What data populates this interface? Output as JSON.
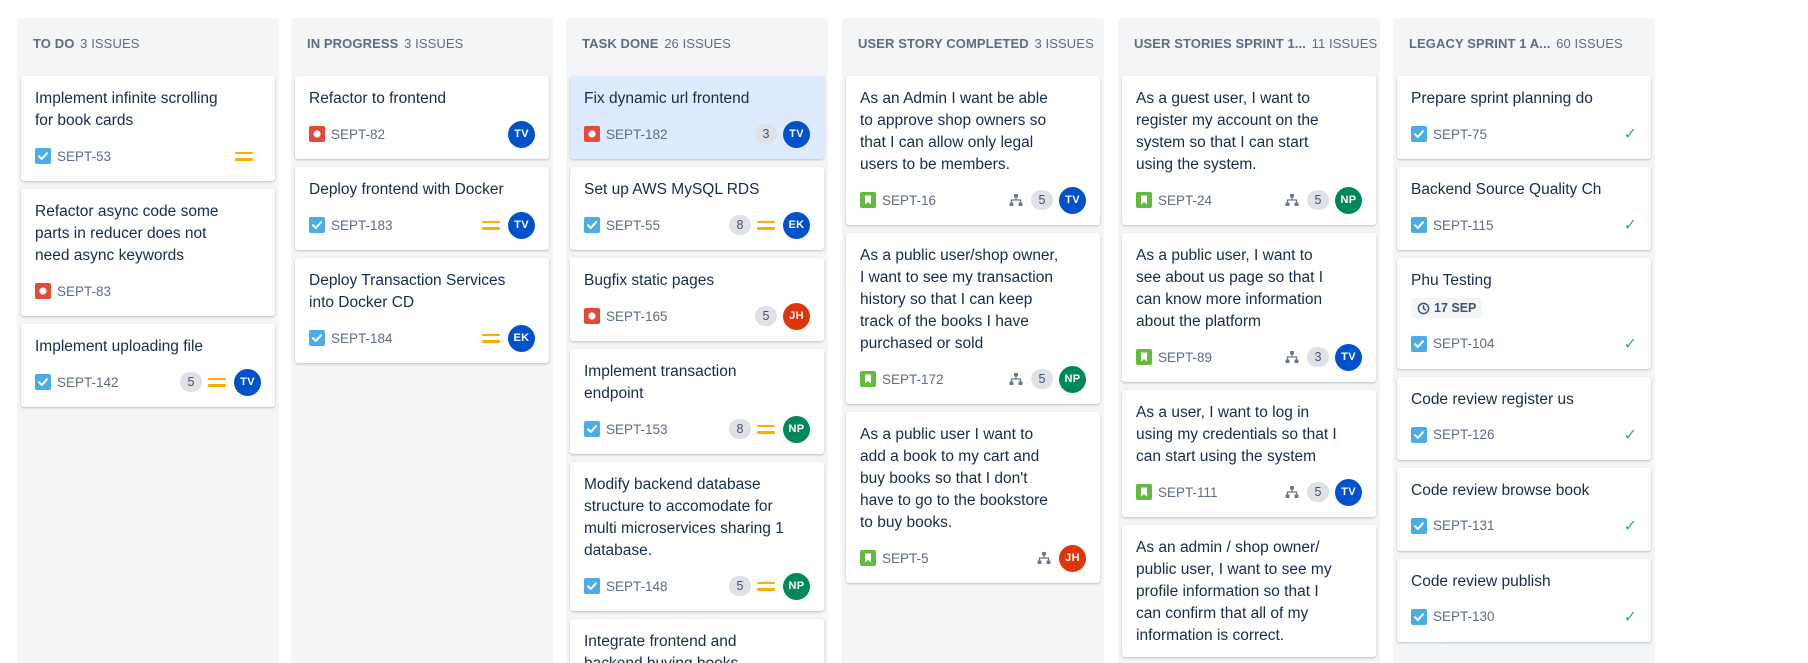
{
  "columns": [
    {
      "name": "TO DO",
      "count": "3 ISSUES",
      "cards": [
        {
          "title": "Implement infinite scrolling for book cards",
          "type": "task",
          "key": "SEPT-53",
          "estimate": "",
          "priority": "medium",
          "subtasks": false,
          "assignee": null
        },
        {
          "title": "Refactor async code some parts in reducer does not need async keywords",
          "type": "bug",
          "key": "SEPT-83",
          "estimate": "",
          "priority": "",
          "subtasks": false,
          "assignee": null
        },
        {
          "title": "Implement uploading file",
          "type": "task",
          "key": "SEPT-142",
          "estimate": "5",
          "priority": "medium",
          "subtasks": false,
          "assignee": "TV"
        }
      ]
    },
    {
      "name": "IN PROGRESS",
      "count": "3 ISSUES",
      "cards": [
        {
          "title": "Refactor to frontend",
          "type": "bug",
          "key": "SEPT-82",
          "estimate": "",
          "priority": "",
          "subtasks": false,
          "assignee": "TV"
        },
        {
          "title": "Deploy frontend with Docker",
          "type": "task",
          "key": "SEPT-183",
          "estimate": "",
          "priority": "medium",
          "subtasks": false,
          "assignee": "TV"
        },
        {
          "title": "Deploy Transaction Services into Docker CD",
          "type": "task",
          "key": "SEPT-184",
          "estimate": "",
          "priority": "medium",
          "subtasks": false,
          "assignee": "EK"
        }
      ]
    },
    {
      "name": "TASK DONE",
      "count": "26 ISSUES",
      "cards": [
        {
          "title": "Fix dynamic url frontend",
          "type": "bug",
          "key": "SEPT-182",
          "estimate": "3",
          "priority": "",
          "subtasks": false,
          "assignee": "TV",
          "selected": true
        },
        {
          "title": "Set up AWS MySQL RDS",
          "type": "task",
          "key": "SEPT-55",
          "estimate": "8",
          "priority": "medium",
          "subtasks": false,
          "assignee": "EK"
        },
        {
          "title": "Bugfix static pages",
          "type": "bug",
          "key": "SEPT-165",
          "estimate": "5",
          "priority": "",
          "subtasks": false,
          "assignee": "JH"
        },
        {
          "title": "Implement transaction endpoint",
          "type": "task",
          "key": "SEPT-153",
          "estimate": "8",
          "priority": "medium",
          "subtasks": false,
          "assignee": "NP"
        },
        {
          "title": "Modify backend database structure to accomodate for multi microservices sharing 1 database.",
          "type": "task",
          "key": "SEPT-148",
          "estimate": "5",
          "priority": "medium",
          "subtasks": false,
          "assignee": "NP"
        },
        {
          "title": "Integrate frontend and backend buying books",
          "type": "task",
          "key": "",
          "estimate": "",
          "priority": "",
          "subtasks": false,
          "assignee": null
        }
      ]
    },
    {
      "name": "USER STORY COMPLETED",
      "count": "3 ISSUES",
      "cards": [
        {
          "title": "As an Admin I want be able to approve shop owners so that I can allow only legal users to be members.",
          "type": "story",
          "key": "SEPT-16",
          "estimate": "5",
          "priority": "",
          "subtasks": true,
          "assignee": "TV"
        },
        {
          "title": "As a public user/shop owner, I want to see my transaction history so that I can keep track of the books I have purchased or sold",
          "type": "story",
          "key": "SEPT-172",
          "estimate": "5",
          "priority": "",
          "subtasks": true,
          "assignee": "NP"
        },
        {
          "title": "As a public user I want to add a book to my cart and buy books so that I don't have to go to the bookstore to buy books.",
          "type": "story",
          "key": "SEPT-5",
          "estimate": "",
          "priority": "",
          "subtasks": true,
          "assignee": "JH"
        }
      ]
    },
    {
      "name": "USER STORIES SPRINT 1...",
      "count": "11 ISSUES",
      "cards": [
        {
          "title": "As a guest user, I want to register my account on the system so that I can start using the system.",
          "type": "story",
          "key": "SEPT-24",
          "estimate": "5",
          "priority": "",
          "subtasks": true,
          "assignee": "NP"
        },
        {
          "title": "As a public user, I want to see about us page so that I can know more information about the platform",
          "type": "story",
          "key": "SEPT-89",
          "estimate": "3",
          "priority": "",
          "subtasks": true,
          "assignee": "TV"
        },
        {
          "title": "As a user, I want to log in using my credentials so that I can start using the system",
          "type": "story",
          "key": "SEPT-111",
          "estimate": "5",
          "priority": "",
          "subtasks": true,
          "assignee": "TV"
        },
        {
          "title": "As an admin / shop owner/ public user, I want to see my profile information so that I can confirm that all of my information is correct.",
          "type": "story",
          "key": "",
          "estimate": "",
          "priority": "",
          "subtasks": false,
          "assignee": null
        }
      ]
    },
    {
      "name": "LEGACY SPRINT 1 A...",
      "count": "60 ISSUES",
      "cards": [
        {
          "title": "Prepare sprint planning do",
          "type": "task",
          "key": "SEPT-75",
          "estimate": "",
          "priority": "",
          "subtasks": false,
          "assignee": null,
          "done": "✓"
        },
        {
          "title": "Backend Source Quality Ch",
          "type": "task",
          "key": "SEPT-115",
          "estimate": "",
          "priority": "",
          "subtasks": false,
          "assignee": null,
          "done": "✓"
        },
        {
          "title": "Phu Testing",
          "type": "task",
          "key": "SEPT-104",
          "estimate": "",
          "priority": "",
          "subtasks": false,
          "assignee": null,
          "done": "✓",
          "date": "17 SEP"
        },
        {
          "title": "Code review register us",
          "type": "task",
          "key": "SEPT-126",
          "estimate": "",
          "priority": "",
          "subtasks": false,
          "assignee": null,
          "done": "✓"
        },
        {
          "title": "Code review browse book",
          "type": "task",
          "key": "SEPT-131",
          "estimate": "",
          "priority": "",
          "subtasks": false,
          "assignee": null,
          "done": "✓"
        },
        {
          "title": "Code review publish",
          "type": "task",
          "key": "SEPT-130",
          "estimate": "",
          "priority": "",
          "subtasks": false,
          "assignee": null,
          "done": "✓"
        }
      ]
    }
  ],
  "colors": {
    "task": "#4bade8",
    "bug": "#e5493a",
    "story": "#63ba3c",
    "priority_medium": "#ffab00",
    "done_check": "#36b37e",
    "selected_card": "#deebff"
  },
  "avatars": {
    "TV": "#0052cc",
    "EK": "#0052cc",
    "NP": "#00875a",
    "JH": "#de350b"
  },
  "icons": {
    "task": "checkbox-icon",
    "bug": "bug-icon",
    "story": "bookmark-icon",
    "subtasks": "subtask-tree-icon",
    "priority_medium": "priority-medium-icon",
    "date": "clock-icon",
    "done": "checkmark-icon"
  }
}
